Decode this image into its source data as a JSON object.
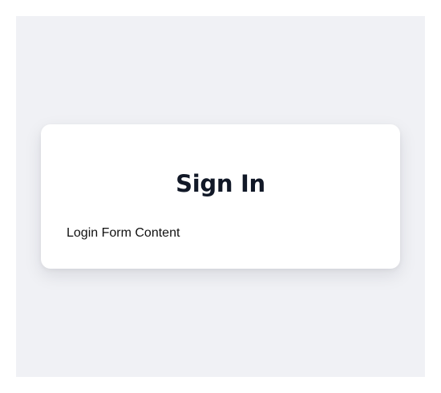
{
  "login_card": {
    "title": "Sign In",
    "body_text": "Login Form Content"
  },
  "colors": {
    "page_background": "#f0f1f5",
    "card_background": "#ffffff",
    "title_text": "#111827",
    "body_text": "#111111"
  }
}
